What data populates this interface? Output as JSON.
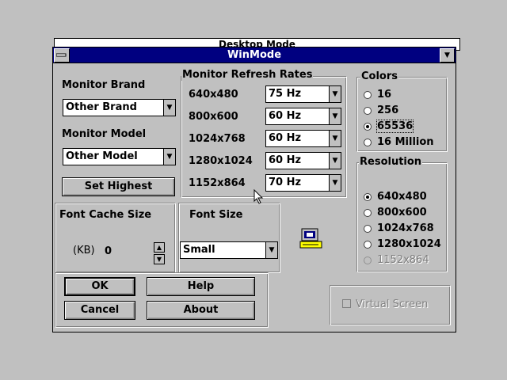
{
  "background_window": {
    "title": "Desktop Mode"
  },
  "window": {
    "title": "WinMode",
    "menu_icon": "control-menu-icon",
    "minimize_icon": "minimize-arrow-icon"
  },
  "monitor": {
    "brand_label": "Monitor Brand",
    "brand_value": "Other Brand",
    "model_label": "Monitor Model",
    "model_value": "Other Model",
    "set_highest": "Set Highest"
  },
  "refresh": {
    "title": "Monitor Refresh Rates",
    "rows": [
      {
        "mode": "640x480",
        "rate": "75 Hz"
      },
      {
        "mode": "800x600",
        "rate": "60 Hz"
      },
      {
        "mode": "1024x768",
        "rate": "60 Hz"
      },
      {
        "mode": "1280x1024",
        "rate": "60 Hz"
      },
      {
        "mode": "1152x864",
        "rate": "70 Hz"
      }
    ]
  },
  "colors": {
    "title": "Colors",
    "options": [
      "16",
      "256",
      "65536",
      "16 Million"
    ],
    "selected": "65536"
  },
  "resolution": {
    "title": "Resolution",
    "options": [
      "640x480",
      "800x600",
      "1024x768",
      "1280x1024",
      "1152x864"
    ],
    "selected": "640x480",
    "disabled": [
      "1152x864"
    ]
  },
  "font_cache": {
    "title": "Font Cache Size",
    "unit": "(KB)",
    "value": "0"
  },
  "font_size": {
    "title": "Font Size",
    "value": "Small"
  },
  "buttons": {
    "ok": "OK",
    "help": "Help",
    "cancel": "Cancel",
    "about": "About"
  },
  "virtual_screen": {
    "label": "Virtual Screen",
    "checked": false,
    "disabled": true
  },
  "icons": {
    "monitor": "monitor-icon",
    "dropdown": "dropdown-arrow-icon",
    "cursor": "mouse-pointer-icon"
  },
  "colors_palette": {
    "face": "#c0c0c0",
    "titlebar": "#000080",
    "disabled_text": "#808080"
  }
}
